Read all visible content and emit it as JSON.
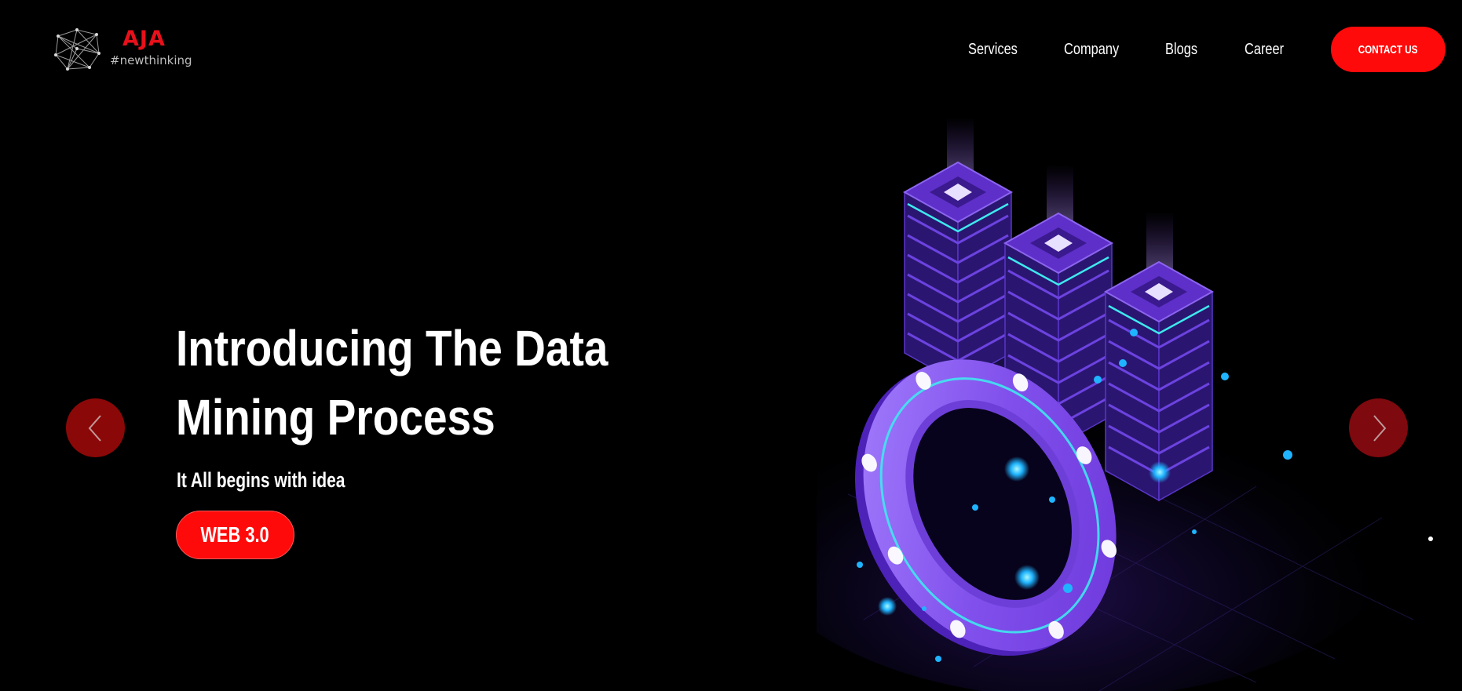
{
  "brand": {
    "name": "AJA",
    "tagline": "#newthinking"
  },
  "nav": {
    "items": [
      "Services",
      "Company",
      "Blogs",
      "Career"
    ],
    "contact_label": "CONTACT US"
  },
  "hero": {
    "title_line1": "Introducing The Data",
    "title_line2": "Mining Process",
    "subtitle": "It All begins with idea",
    "button_label": "WEB 3.0"
  },
  "colors": {
    "background": "#000000",
    "accent": "#ff0a0a",
    "illustration_primary": "#7b3fe0",
    "illustration_glow": "#2fd6e6"
  },
  "icons": {
    "prev": "chevron-left-icon",
    "next": "chevron-right-icon",
    "logo": "network-globe-icon"
  }
}
